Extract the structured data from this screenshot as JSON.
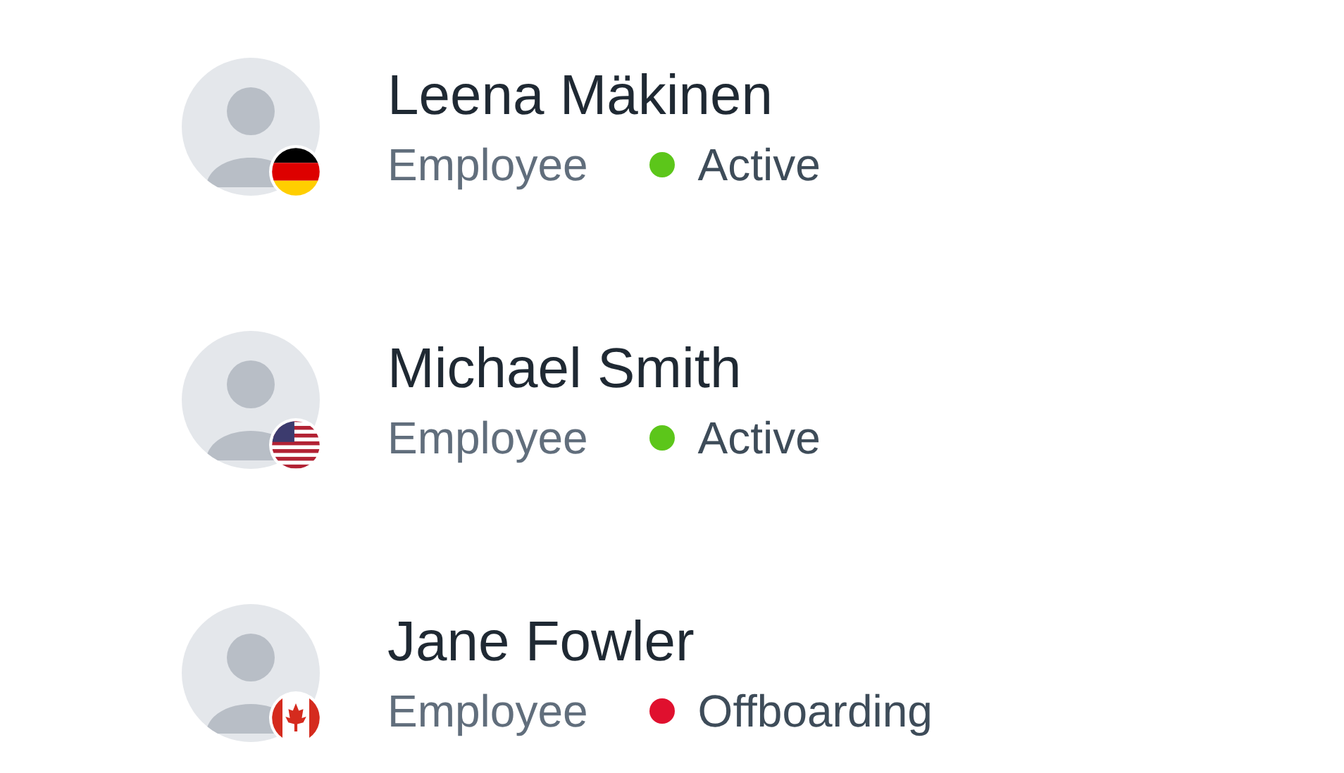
{
  "people": [
    {
      "name": "Leena Mäkinen",
      "role": "Employee",
      "status": "Active",
      "color": "#5cc61a",
      "flag": {
        "kind": "de"
      }
    },
    {
      "name": "Michael Smith",
      "role": "Employee",
      "status": "Active",
      "color": "#5cc61a",
      "flag": {
        "kind": "us"
      }
    },
    {
      "name": "Jane Fowler",
      "role": "Employee",
      "status": "Offboarding",
      "color": "#e0102e",
      "flag": {
        "kind": "ca"
      }
    }
  ]
}
